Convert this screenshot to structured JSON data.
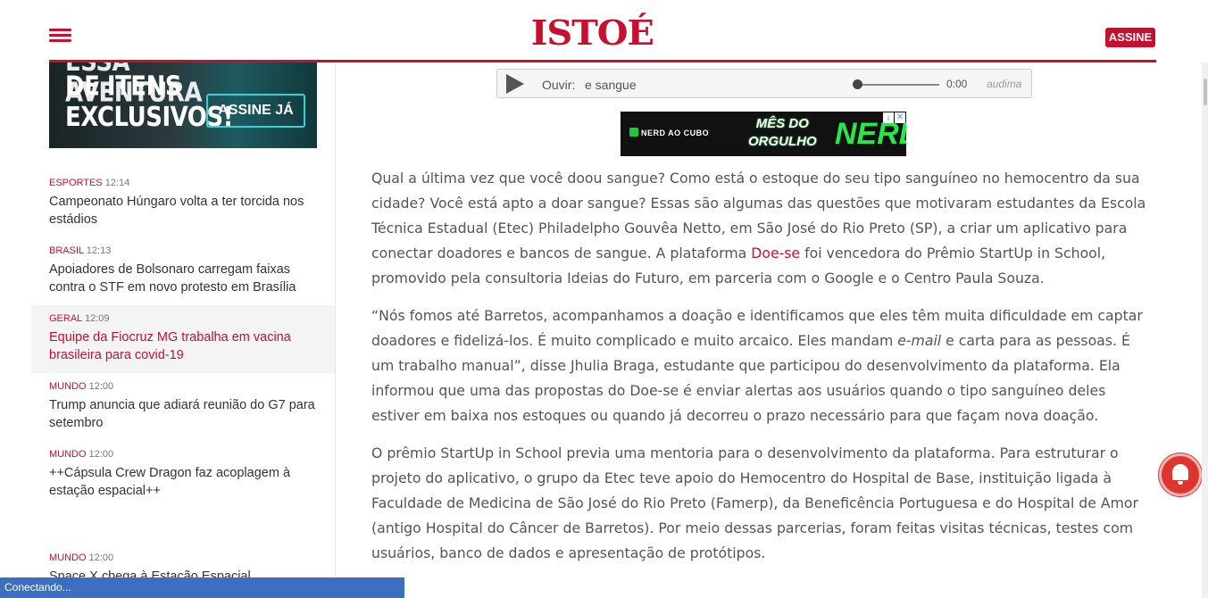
{
  "header": {
    "logo": "ISTOÉ",
    "subscribe_label": "ASSINE"
  },
  "sidebar": {
    "ad": {
      "line_cut": "ESSA AVENTURA",
      "line1": "DE ITENS",
      "line2": "EXCLUSIVOS!",
      "cta": "ASSINE JÁ"
    },
    "news": [
      {
        "category": "ESPORTES",
        "time": "12:14",
        "title": "Campeonato Húngaro volta a ter torcida nos estádios"
      },
      {
        "category": "BRASIL",
        "time": "12:13",
        "title": "Apoiadores de Bolsonaro carregam faixas contra o STF em novo protesto em Brasília"
      },
      {
        "category": "GERAL",
        "time": "12:09",
        "title": "Equipe da Fiocruz MG trabalha em vacina brasileira para covid-19"
      },
      {
        "category": "MUNDO",
        "time": "12:00",
        "title": "Trump anuncia que adiará reunião do G7 para setembro"
      },
      {
        "category": "MUNDO",
        "time": "12:00",
        "title": "++Cápsula Crew Dragon faz acoplagem à estação espacial++"
      },
      {
        "category": "MUNDO",
        "time": "12:00",
        "title": "Space X chega à Estação Espacial"
      }
    ]
  },
  "audio": {
    "label": "Ouvir:",
    "track": "e sangue",
    "time": "0:00",
    "brand": "audima"
  },
  "banner": {
    "brand": "NERD AO CUBO",
    "headline_1": "MÊS DO",
    "headline_2": "ORGULHO",
    "brand_big": "NERD",
    "info": "i",
    "close": "✕"
  },
  "article": {
    "p1_a": "Qual a última vez que você doou sangue? Como está o estoque do seu tipo sanguíneo no hemocentro da sua cidade? Você está apto a doar sangue? Essas são algumas das questões que motivaram estudantes da Escola Técnica Estadual (Etec) Philadelpho Gouvêa Netto, em São José do Rio Preto (SP), a criar um aplicativo para conectar doadores e bancos de sangue. A plataforma ",
    "p1_link": "Doe-se",
    "p1_b": " foi vencedora do Prêmio StartUp in School, promovido pela consultoria Ideias do Futuro, em parceria com o Google e o Centro Paula Souza.",
    "p2_a": "“Nós fomos até Barretos, acompanhamos a doação e identificamos que eles têm muita dificuldade em captar doadores e fidelizá-los. É muito complicado e muito arcaico. Eles mandam ",
    "p2_em": "e-mail",
    "p2_b": " e carta para as pessoas. É um trabalho manual”, disse Jhulia Braga, estudante que participou do desenvolvimento da plataforma. Ela informou que uma das propostas do Doe-se é enviar alertas aos usuários quando o tipo sanguíneo deles estiver em baixa nos estoques ou quando já decorreu o prazo necessário para que façam nova doação.",
    "p3": "O prêmio StartUp in School previa uma mentoria para o desenvolvimento da plataforma. Para estruturar o projeto do aplicativo, o grupo da Etec teve apoio do Hemocentro do Hospital de Base, instituição ligada à Faculdade de Medicina de São José do Rio Preto (Famerp), da Beneficência Portuguesa e do Hospital de Amor (antigo Hospital do Câncer de Barretos). Por meio dessas parcerias, foram feitas visitas técnicas, testes com usuários, banco de dados e apresentação de protótipos."
  },
  "status_bar": "Conectando...",
  "colors": {
    "brand_red": "#c8102e",
    "status_blue": "#3d6fc0",
    "bell_red": "#e0342f"
  }
}
